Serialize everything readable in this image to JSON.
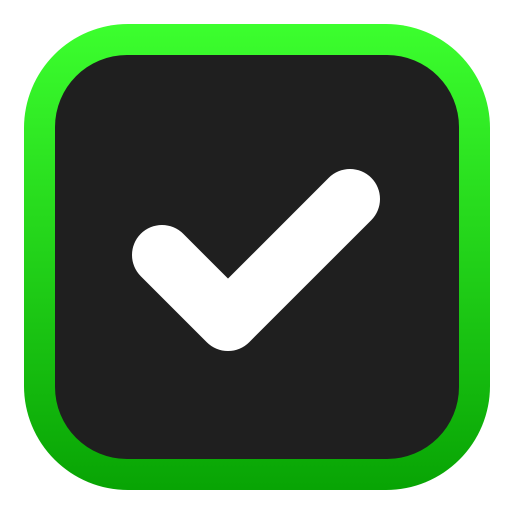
{
  "icon": {
    "name": "checkmark-checkbox-icon",
    "state": "checked",
    "colors": {
      "border_gradient_top": "#3cff2e",
      "border_gradient_bottom": "#08a404",
      "inner_fill": "#1f1f1f",
      "checkmark": "#ffffff",
      "background": "#ffffff"
    }
  }
}
